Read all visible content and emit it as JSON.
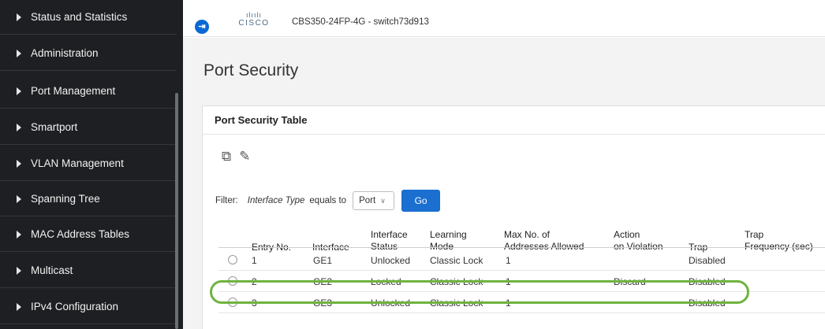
{
  "sidebar": {
    "items": [
      {
        "label": "Status and Statistics"
      },
      {
        "label": "Administration"
      },
      {
        "label": "Port Management"
      },
      {
        "label": "Smartport"
      },
      {
        "label": "VLAN Management"
      },
      {
        "label": "Spanning Tree"
      },
      {
        "label": "MAC Address Tables"
      },
      {
        "label": "Multicast"
      },
      {
        "label": "IPv4 Configuration"
      }
    ]
  },
  "header": {
    "logo_bars": "ılıılı",
    "logo_text": "CISCO",
    "device_name": "CBS350-24FP-4G - switch73d913"
  },
  "page": {
    "title": "Port Security",
    "panel_title": "Port Security Table"
  },
  "filter": {
    "label": "Filter:",
    "field": "Interface Type",
    "operator": "equals to",
    "value": "Port",
    "go_label": "Go"
  },
  "table": {
    "headers": {
      "entry_no": "Entry No.",
      "interface": "Interface",
      "interface_status_1": "Interface",
      "interface_status_2": "Status",
      "learning_mode_1": "Learning",
      "learning_mode_2": "Mode",
      "max_addr_1": "Max No. of",
      "max_addr_2": "Addresses Allowed",
      "action_1": "Action",
      "action_2": "on Violation",
      "trap": "Trap",
      "trap_freq_1": "Trap",
      "trap_freq_2": "Frequency (sec)"
    },
    "rows": [
      {
        "entry": "1",
        "interface": "GE1",
        "status": "Unlocked",
        "mode": "Classic Lock",
        "max": "1",
        "action": "",
        "trap": "Disabled"
      },
      {
        "entry": "2",
        "interface": "GE2",
        "status": "Locked",
        "mode": "Classic Lock",
        "max": "1",
        "action": "Discard",
        "trap": "Disabled"
      },
      {
        "entry": "3",
        "interface": "GE3",
        "status": "Unlocked",
        "mode": "Classic Lock",
        "max": "1",
        "action": "",
        "trap": "Disabled"
      }
    ]
  },
  "colors": {
    "sidebar_bg": "#1d1f22",
    "accent": "#1a6fd0",
    "highlight": "#6fb33f"
  }
}
